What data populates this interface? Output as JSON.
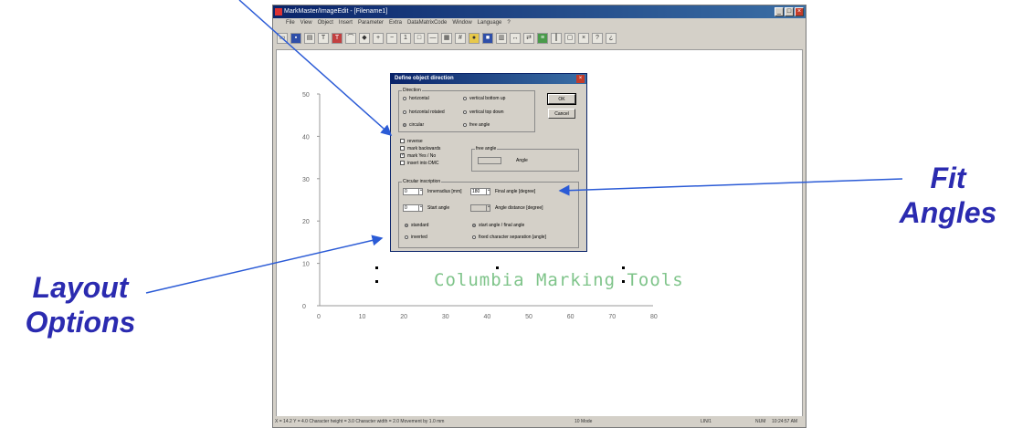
{
  "callouts": {
    "layout": [
      "Layout",
      "Options"
    ],
    "fit": [
      "Fit",
      "Angles"
    ]
  },
  "window": {
    "title": "MarkMaster/ImageEdit - [Filename1]",
    "menu": [
      "File",
      "View",
      "Object",
      "Insert",
      "Parameter",
      "Extra",
      "DataMatrixCode",
      "Window",
      "Language",
      "?"
    ],
    "toolbar_icons": [
      "open-icon",
      "save-icon",
      "print-icon",
      "text-icon",
      "text-frame-icon",
      "arc-text-icon",
      "logo-icon",
      "zoom-in-icon",
      "zoom-out-icon",
      "zoom-1-1-icon",
      "zoom-fit-icon",
      "line-icon",
      "datamatrix-icon",
      "grid-icon",
      "color-icon",
      "mark-icon",
      "table-icon",
      "move-icon",
      "flip-icon",
      "align-icon",
      "barcode-icon",
      "frame-icon",
      "delete-icon",
      "help-icon",
      "context-help-icon"
    ]
  },
  "plot": {
    "yticks": [
      "50",
      "40",
      "30",
      "20",
      "10",
      "0"
    ],
    "xticks": [
      "0",
      "10",
      "20",
      "30",
      "40",
      "50",
      "60",
      "70",
      "80"
    ],
    "marking_text": "Columbia Marking Tools"
  },
  "dialog": {
    "title": "Define object direction",
    "ok_label": "OK",
    "cancel_label": "Cancel",
    "direction": {
      "label": "Direction",
      "options": [
        "horizontal",
        "horizontal rotated",
        "circular",
        "vertical bottom up",
        "vertical top down",
        "free angle"
      ],
      "selected": "circular"
    },
    "checks": [
      {
        "label": "reverse",
        "checked": false
      },
      {
        "label": "mark backwards",
        "checked": false
      },
      {
        "label": "mark Yes / No",
        "checked": true
      },
      {
        "label": "insert into DMC",
        "checked": false
      }
    ],
    "free_angle": {
      "label": "free angle",
      "angle_label": "Angle"
    },
    "circular": {
      "label": "Circular inscription",
      "radius_value": "0",
      "radius_label": "Innerradius [mm]",
      "final_angle_value": "180",
      "final_angle_label": "Final angle [degree]",
      "start_angle_value": "0",
      "start_angle_label": "Start angle",
      "angle_distance_label": "Angle distance [degree]",
      "placement_options": [
        "standard",
        "inverted"
      ],
      "angle_mode_options": [
        "start angle / final angle",
        "fixed character separation [angle]"
      ]
    }
  },
  "status": {
    "left": "X = 14.2  Y = 4.0  Character height = 3.0  Character width = 2.0  Movement by 1.0 mm",
    "mode": "10 Mode",
    "caps": "LIN/1",
    "num": "NUM",
    "time": "10:24:57 AM"
  }
}
